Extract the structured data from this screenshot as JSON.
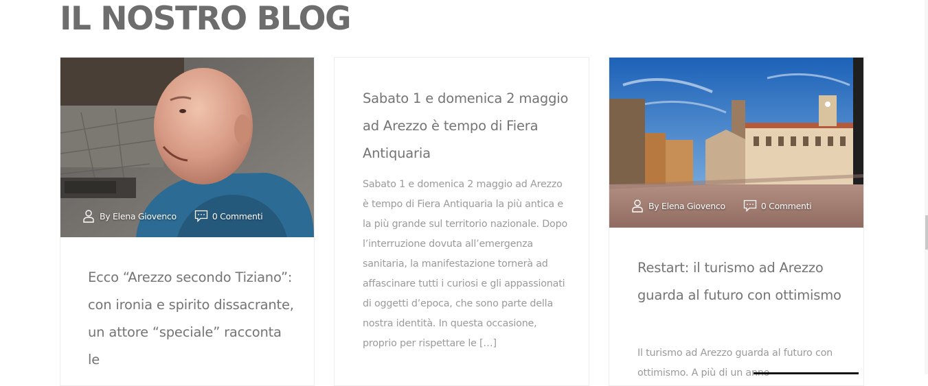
{
  "section": {
    "title": "IL NOSTRO BLOG"
  },
  "posts": [
    {
      "title": "Ecco “Arezzo secondo Tiziano”: con ironia e spirito dissacrante, un attore “speciale” racconta le",
      "author": "By Elena Giovenco",
      "comments": "0 Commenti",
      "excerpt": ""
    },
    {
      "title": "Sabato 1 e domenica 2 maggio ad Arezzo è tempo di Fiera Antiquaria",
      "author": "",
      "comments": "",
      "excerpt": "Sabato 1 e domenica 2 maggio ad Arezzo è tempo di Fiera Antiquaria la più antica e la più grande sul territorio nazionale. Dopo l’interruzione dovuta all’emergenza sanitaria, la manifestazione tornerà ad affascinare tutti i curiosi e gli appassionati di oggetti d’epoca, che sono parte della nostra identità. In questa occasione, proprio per rispettare le […]"
    },
    {
      "title": "Restart: il turismo ad Arezzo guarda al futuro con ottimismo",
      "author": "By Elena Giovenco",
      "comments": "0 Commenti",
      "excerpt": "Il turismo ad Arezzo guarda al futuro con ottimismo. A più di un anno"
    }
  ],
  "icons": {
    "author": "user-icon",
    "comments": "comment-icon"
  },
  "colors": {
    "title": "#6d6d6d",
    "text": "#747474",
    "excerpt": "#9a9a9a"
  }
}
